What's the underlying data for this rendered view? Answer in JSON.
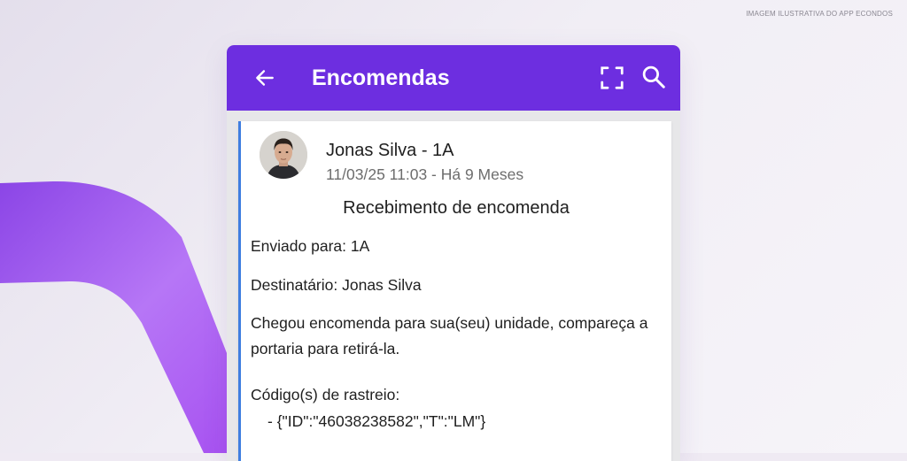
{
  "caption": "IMAGEM ILUSTRATIVA DO APP ECONDOS",
  "colors": {
    "appbar": "#6d2ee0",
    "accent_border": "#3f7ee0",
    "decor_shape": "#a55df0"
  },
  "appbar": {
    "title": "Encomendas",
    "icons": [
      "arrow-back-icon",
      "scan-frame-icon",
      "search-icon"
    ]
  },
  "notification": {
    "sender": "Jonas Silva - 1A",
    "timestamp": "11/03/25 11:03 - Há 9 Meses",
    "subject": "Recebimento de encomenda",
    "sent_to": "Enviado para: 1A",
    "recipient": "Destinatário: Jonas Silva",
    "message": "Chegou encomenda para sua(seu) unidade, compareça a portaria para retirá-la.",
    "tracking_label": "Código(s) de rastreio:",
    "tracking_items": [
      "- {\"ID\":\"46038238582\",\"T\":\"LM\"}"
    ]
  }
}
